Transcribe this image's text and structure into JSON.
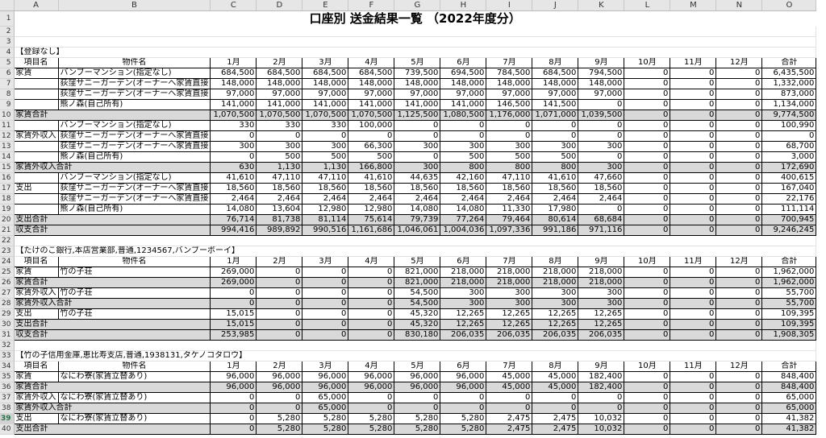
{
  "title": "口座別 送金結果一覧 （2022年度分）",
  "columns": [
    "A",
    "B",
    "C",
    "D",
    "E",
    "F",
    "G",
    "H",
    "I",
    "J",
    "K",
    "L",
    "M",
    "N",
    "O"
  ],
  "header": {
    "item": "項目名",
    "prop": "物件名",
    "months": [
      "1月",
      "2月",
      "3月",
      "4月",
      "5月",
      "6月",
      "7月",
      "8月",
      "9月",
      "10月",
      "11月",
      "12月"
    ],
    "total": "合計"
  },
  "selected_row": 39,
  "rows": [
    {
      "r": 4,
      "t": "section",
      "label": "【登録なし】"
    },
    {
      "r": 5,
      "t": "header"
    },
    {
      "r": 6,
      "t": "data",
      "a": "家賃",
      "b": "バンブーマンション(指定なし)",
      "v": [
        "684,500",
        "684,500",
        "684,500",
        "684,500",
        "739,500",
        "694,500",
        "784,500",
        "684,500",
        "794,500",
        "0",
        "0",
        "0",
        "6,435,500"
      ]
    },
    {
      "r": 7,
      "t": "data",
      "a": "",
      "b": "荻窪サニーガーデン(オーナーへ家賃直接",
      "v": [
        "148,000",
        "148,000",
        "148,000",
        "148,000",
        "148,000",
        "148,000",
        "148,000",
        "148,000",
        "148,000",
        "0",
        "0",
        "0",
        "1,332,000"
      ]
    },
    {
      "r": 8,
      "t": "data",
      "a": "",
      "b": "荻窪サニーガーデン(オーナーへ家賃直接",
      "v": [
        "97,000",
        "97,000",
        "97,000",
        "97,000",
        "97,000",
        "97,000",
        "97,000",
        "97,000",
        "97,000",
        "0",
        "0",
        "0",
        "873,000"
      ]
    },
    {
      "r": 9,
      "t": "data",
      "a": "",
      "b": "熊ノ森(自己所有)",
      "v": [
        "141,000",
        "141,000",
        "141,000",
        "141,000",
        "141,000",
        "141,000",
        "146,500",
        "141,500",
        "0",
        "0",
        "0",
        "0",
        "1,134,000"
      ]
    },
    {
      "r": 10,
      "t": "total",
      "a": "家賃合計",
      "v": [
        "1,070,500",
        "1,070,500",
        "1,070,500",
        "1,070,500",
        "1,125,500",
        "1,080,500",
        "1,176,000",
        "1,071,000",
        "1,039,500",
        "0",
        "0",
        "0",
        "9,774,500"
      ]
    },
    {
      "r": 11,
      "t": "data",
      "a": "",
      "b": "バンブーマンション(指定なし)",
      "v": [
        "330",
        "330",
        "330",
        "100,000",
        "0",
        "0",
        "0",
        "0",
        "0",
        "0",
        "0",
        "0",
        "100,990"
      ]
    },
    {
      "r": 12,
      "t": "data",
      "a": "家賃外収入",
      "b": "荻窪サニーガーデン(オーナーへ家賃直接",
      "v": [
        "0",
        "0",
        "0",
        "0",
        "0",
        "0",
        "0",
        "0",
        "0",
        "0",
        "0",
        "0",
        "0"
      ]
    },
    {
      "r": 13,
      "t": "data",
      "a": "",
      "b": "荻窪サニーガーデン(オーナーへ家賃直接",
      "v": [
        "300",
        "300",
        "300",
        "66,300",
        "300",
        "300",
        "300",
        "300",
        "300",
        "0",
        "0",
        "0",
        "68,700"
      ]
    },
    {
      "r": 14,
      "t": "data",
      "a": "",
      "b": "熊ノ森(自己所有)",
      "v": [
        "0",
        "500",
        "500",
        "500",
        "0",
        "500",
        "500",
        "500",
        "0",
        "0",
        "0",
        "0",
        "3,000"
      ]
    },
    {
      "r": 15,
      "t": "total",
      "a": "家賃外収入合計",
      "v": [
        "630",
        "1,130",
        "1,130",
        "166,800",
        "300",
        "800",
        "800",
        "800",
        "300",
        "0",
        "0",
        "0",
        "172,690"
      ]
    },
    {
      "r": 16,
      "t": "data",
      "a": "",
      "b": "バンブーマンション(指定なし)",
      "v": [
        "41,610",
        "47,110",
        "47,110",
        "41,610",
        "44,635",
        "42,160",
        "47,110",
        "41,610",
        "47,660",
        "0",
        "0",
        "0",
        "400,615"
      ]
    },
    {
      "r": 17,
      "t": "data",
      "a": "支出",
      "b": "荻窪サニーガーデン(オーナーへ家賃直接",
      "v": [
        "18,560",
        "18,560",
        "18,560",
        "18,560",
        "18,560",
        "18,560",
        "18,560",
        "18,560",
        "18,560",
        "0",
        "0",
        "0",
        "167,040"
      ]
    },
    {
      "r": 18,
      "t": "data",
      "a": "",
      "b": "荻窪サニーガーデン(オーナーへ家賃直接",
      "v": [
        "2,464",
        "2,464",
        "2,464",
        "2,464",
        "2,464",
        "2,464",
        "2,464",
        "2,464",
        "2,464",
        "0",
        "0",
        "0",
        "22,176"
      ]
    },
    {
      "r": 19,
      "t": "data",
      "a": "",
      "b": "熊ノ森(自己所有)",
      "v": [
        "14,080",
        "13,604",
        "12,980",
        "12,980",
        "14,080",
        "14,080",
        "11,330",
        "17,980",
        "0",
        "0",
        "0",
        "0",
        "111,114"
      ]
    },
    {
      "r": 20,
      "t": "total",
      "a": "支出合計",
      "v": [
        "76,714",
        "81,738",
        "81,114",
        "75,614",
        "79,739",
        "77,264",
        "79,464",
        "80,614",
        "68,684",
        "0",
        "0",
        "0",
        "700,945"
      ]
    },
    {
      "r": 21,
      "t": "total",
      "a": "収支合計",
      "v": [
        "994,416",
        "989,892",
        "990,516",
        "1,161,686",
        "1,046,061",
        "1,004,036",
        "1,097,336",
        "991,186",
        "971,116",
        "0",
        "0",
        "0",
        "9,246,245"
      ]
    },
    {
      "r": 22,
      "t": "blank"
    },
    {
      "r": 23,
      "t": "section",
      "label": "【たけのこ銀行,本店営業部,普通,1234567,バンブーボーイ】"
    },
    {
      "r": 24,
      "t": "header"
    },
    {
      "r": 25,
      "t": "data",
      "a": "家賃",
      "b": "竹の子荘",
      "v": [
        "269,000",
        "0",
        "0",
        "0",
        "821,000",
        "218,000",
        "218,000",
        "218,000",
        "218,000",
        "0",
        "0",
        "0",
        "1,962,000"
      ]
    },
    {
      "r": 26,
      "t": "total",
      "a": "家賃合計",
      "v": [
        "269,000",
        "0",
        "0",
        "0",
        "821,000",
        "218,000",
        "218,000",
        "218,000",
        "218,000",
        "0",
        "0",
        "0",
        "1,962,000"
      ]
    },
    {
      "r": 27,
      "t": "data",
      "a": "家賃外収入",
      "b": "竹の子荘",
      "v": [
        "0",
        "0",
        "0",
        "0",
        "54,500",
        "300",
        "300",
        "300",
        "300",
        "0",
        "0",
        "0",
        "55,700"
      ]
    },
    {
      "r": 28,
      "t": "total",
      "a": "家賃外収入合計",
      "v": [
        "0",
        "0",
        "0",
        "0",
        "54,500",
        "300",
        "300",
        "300",
        "300",
        "0",
        "0",
        "0",
        "55,700"
      ]
    },
    {
      "r": 29,
      "t": "data",
      "a": "支出",
      "b": "竹の子荘",
      "v": [
        "15,015",
        "0",
        "0",
        "0",
        "45,320",
        "12,265",
        "12,265",
        "12,265",
        "12,265",
        "0",
        "0",
        "0",
        "109,395"
      ]
    },
    {
      "r": 30,
      "t": "total",
      "a": "支出合計",
      "v": [
        "15,015",
        "0",
        "0",
        "0",
        "45,320",
        "12,265",
        "12,265",
        "12,265",
        "12,265",
        "0",
        "0",
        "0",
        "109,395"
      ]
    },
    {
      "r": 31,
      "t": "total",
      "a": "収支合計",
      "v": [
        "253,985",
        "0",
        "0",
        "0",
        "830,180",
        "206,035",
        "206,035",
        "206,035",
        "206,035",
        "0",
        "0",
        "0",
        "1,908,305"
      ]
    },
    {
      "r": 32,
      "t": "blank"
    },
    {
      "r": 33,
      "t": "section",
      "label": "【竹の子信用金庫,恵比寿支店,普通,1938131,タケノコタロウ】"
    },
    {
      "r": 34,
      "t": "header"
    },
    {
      "r": 35,
      "t": "data",
      "a": "家賃",
      "b": "なにわ寮(家賃立替あり)",
      "v": [
        "96,000",
        "96,000",
        "96,000",
        "96,000",
        "96,000",
        "96,000",
        "45,000",
        "45,000",
        "182,400",
        "0",
        "0",
        "0",
        "848,400"
      ]
    },
    {
      "r": 36,
      "t": "total",
      "a": "家賃合計",
      "v": [
        "96,000",
        "96,000",
        "96,000",
        "96,000",
        "96,000",
        "96,000",
        "45,000",
        "45,000",
        "182,400",
        "0",
        "0",
        "0",
        "848,400"
      ]
    },
    {
      "r": 37,
      "t": "data",
      "a": "家賃外収入",
      "b": "なにわ寮(家賃立替あり)",
      "v": [
        "0",
        "0",
        "65,000",
        "0",
        "0",
        "0",
        "0",
        "0",
        "0",
        "0",
        "0",
        "0",
        "65,000"
      ]
    },
    {
      "r": 38,
      "t": "total",
      "a": "家賃外収入合計",
      "v": [
        "0",
        "0",
        "65,000",
        "0",
        "0",
        "0",
        "0",
        "0",
        "0",
        "0",
        "0",
        "0",
        "65,000"
      ]
    },
    {
      "r": 39,
      "t": "data",
      "a": "支出",
      "b": "なにわ寮(家賃立替あり)",
      "v": [
        "0",
        "5,280",
        "5,280",
        "5,280",
        "5,280",
        "5,280",
        "2,475",
        "2,475",
        "10,032",
        "0",
        "0",
        "0",
        "41,382"
      ]
    },
    {
      "r": 40,
      "t": "total",
      "a": "支出合計",
      "v": [
        "0",
        "5,280",
        "5,280",
        "5,280",
        "5,280",
        "5,280",
        "2,475",
        "2,475",
        "10,032",
        "0",
        "0",
        "0",
        "41,382"
      ]
    }
  ]
}
